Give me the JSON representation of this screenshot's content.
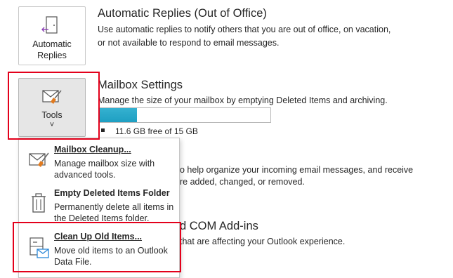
{
  "automatic_replies": {
    "button_label": "Automatic Replies",
    "title": "Automatic Replies (Out of Office)",
    "description": "Use automatic replies to notify others that you are out of office, on vacation, or not available to respond to email messages."
  },
  "tools": {
    "button_label": "Tools",
    "chevron": "˅"
  },
  "mailbox_settings": {
    "title": "Mailbox Settings",
    "description": "Manage the size of your mailbox by emptying Deleted Items and archiving.",
    "usage_fraction": 0.22,
    "free_text": "11.6 GB free of 15 GB"
  },
  "rules_section_partial": {
    "line1": "o help organize your incoming email messages, and receive",
    "line2": "re added, changed, or removed."
  },
  "com_section_partial": {
    "title": "d COM Add-ins",
    "description": "that are affecting your Outlook experience."
  },
  "menu": {
    "items": [
      {
        "title": "Mailbox Cleanup...",
        "description": "Manage mailbox size with advanced tools.",
        "icon": "mailbox-cleanup-icon"
      },
      {
        "title": "Empty Deleted Items Folder",
        "description": "Permanently delete all items in the Deleted Items folder.",
        "icon": "trash-icon"
      },
      {
        "title": "Clean Up Old Items...",
        "description": "Move old items to an Outlook Data File.",
        "icon": "archive-icon"
      }
    ]
  },
  "colors": {
    "highlight": "#e3001b",
    "progress_fill": "#2ea8c9",
    "accent_purple": "#8a3fb4",
    "accent_orange": "#e07a1f",
    "accent_blue": "#2b88d8"
  }
}
